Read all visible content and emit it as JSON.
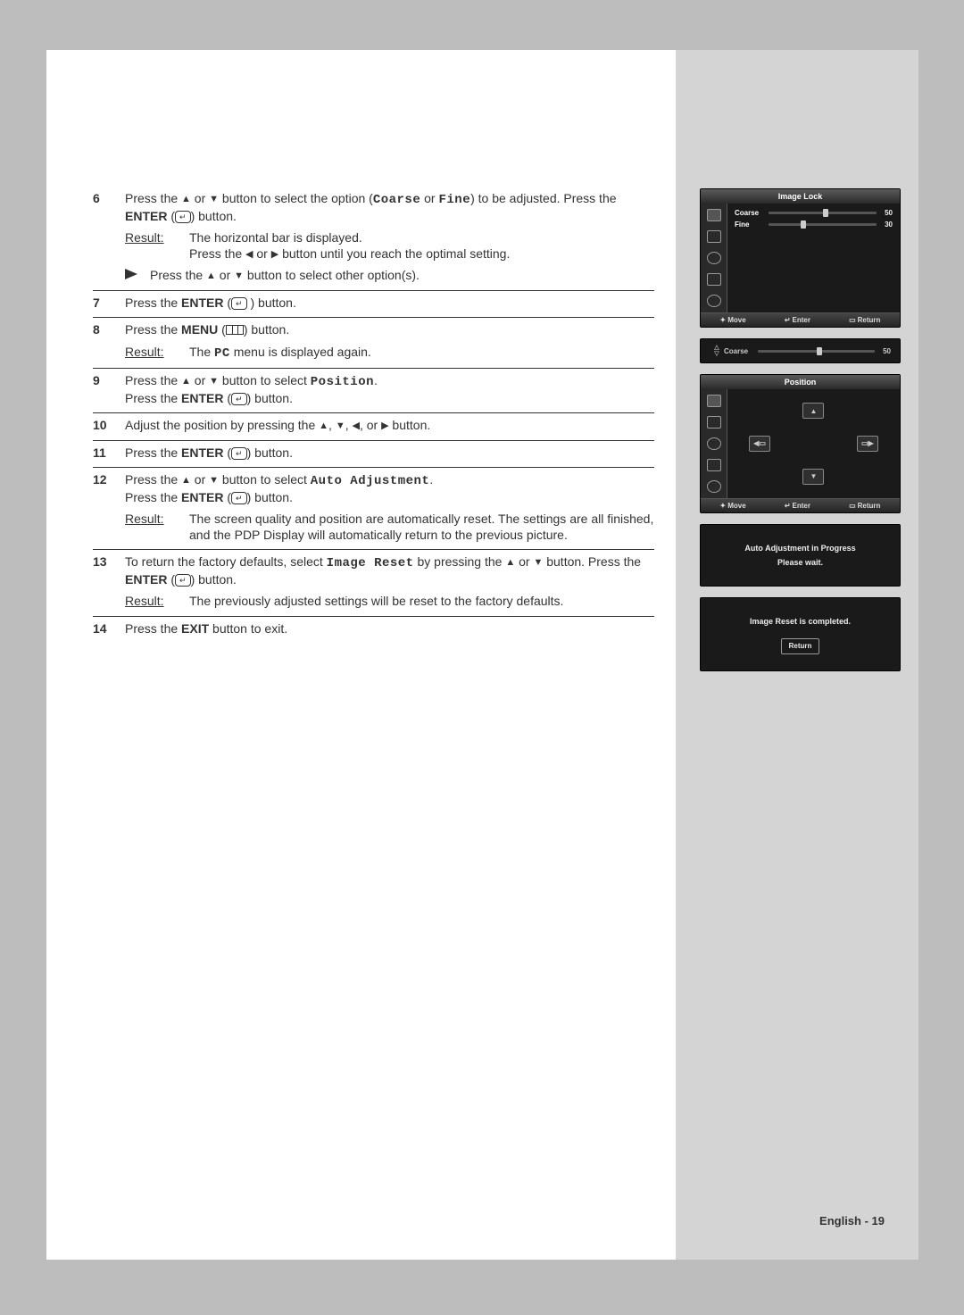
{
  "steps": {
    "s6": {
      "num": "6",
      "line1a": "Press the ",
      "line1b": " or ",
      "line1c": " button to select the option (",
      "coarse": "Coarse",
      "orword": " or ",
      "fine": "Fine",
      "line1d": ") to be adjusted. Press the ",
      "enter": "ENTER",
      "line1e": " button.",
      "resultLabel": "Result:",
      "result1": "The horizontal bar is displayed.",
      "result2a": "Press the ",
      "result2b": " or ",
      "result2c": " button until you reach the optimal setting.",
      "tipPrefix": "Press the ",
      "tipMid": " or ",
      "tipSuffix": " button to select other option(s)."
    },
    "s7": {
      "num": "7",
      "textA": "Press the ",
      "enter": "ENTER",
      "textB": " button."
    },
    "s8": {
      "num": "8",
      "textA": "Press the ",
      "menu": "MENU",
      "textB": " button.",
      "resultLabel": "Result:",
      "result": "The ",
      "pc": "PC",
      "result2": " menu is displayed again."
    },
    "s9": {
      "num": "9",
      "lineA": "Press the ",
      "lineB": " or ",
      "lineC": " button to select ",
      "position": "Position",
      "lineD": ".",
      "line2A": "Press the ",
      "enter": "ENTER",
      "line2B": " button."
    },
    "s10": {
      "num": "10",
      "textA": "Adjust the position by pressing the ",
      "comma": ", ",
      "orw": ", or ",
      "textB": " button."
    },
    "s11": {
      "num": "11",
      "textA": "Press the ",
      "enter": "ENTER",
      "textB": " button."
    },
    "s12": {
      "num": "12",
      "la": "Press the ",
      "lb": " or ",
      "lc": " button to select ",
      "auto": "Auto Adjustment",
      "ld": ".",
      "l2a": "Press the ",
      "enter": "ENTER",
      "l2b": " button.",
      "resultLabel": "Result:",
      "result": "The screen quality and position are automatically reset. The settings are all finished, and the PDP Display will automatically return to the previous picture."
    },
    "s13": {
      "num": "13",
      "la": "To return the factory defaults, select ",
      "ir": "Image Reset",
      "lb": " by pressing the ",
      "lc": " or ",
      "ld": " button. Press the ",
      "enter": "ENTER",
      "le": " button.",
      "resultLabel": "Result:",
      "result": "The previously adjusted settings will be reset to the factory defaults."
    },
    "s14": {
      "num": "14",
      "textA": "Press the ",
      "exit": "EXIT",
      "textB": " button to exit."
    }
  },
  "osd": {
    "imageLock": {
      "title": "Image Lock",
      "rows": [
        {
          "label": "Coarse",
          "value": "50",
          "pos": 50
        },
        {
          "label": "Fine",
          "value": "30",
          "pos": 30
        }
      ],
      "footer": {
        "move": "Move",
        "enter": "Enter",
        "ret": "Return"
      }
    },
    "coarseSlim": {
      "label": "Coarse",
      "value": "50",
      "pos": 50
    },
    "position": {
      "title": "Position",
      "footer": {
        "move": "Move",
        "enter": "Enter",
        "ret": "Return"
      }
    },
    "autoAdj": {
      "line1": "Auto Adjustment in Progress",
      "line2": "Please wait."
    },
    "imgReset": {
      "line1": "Image Reset is completed.",
      "ret": "Return"
    }
  },
  "footer": "English - 19"
}
